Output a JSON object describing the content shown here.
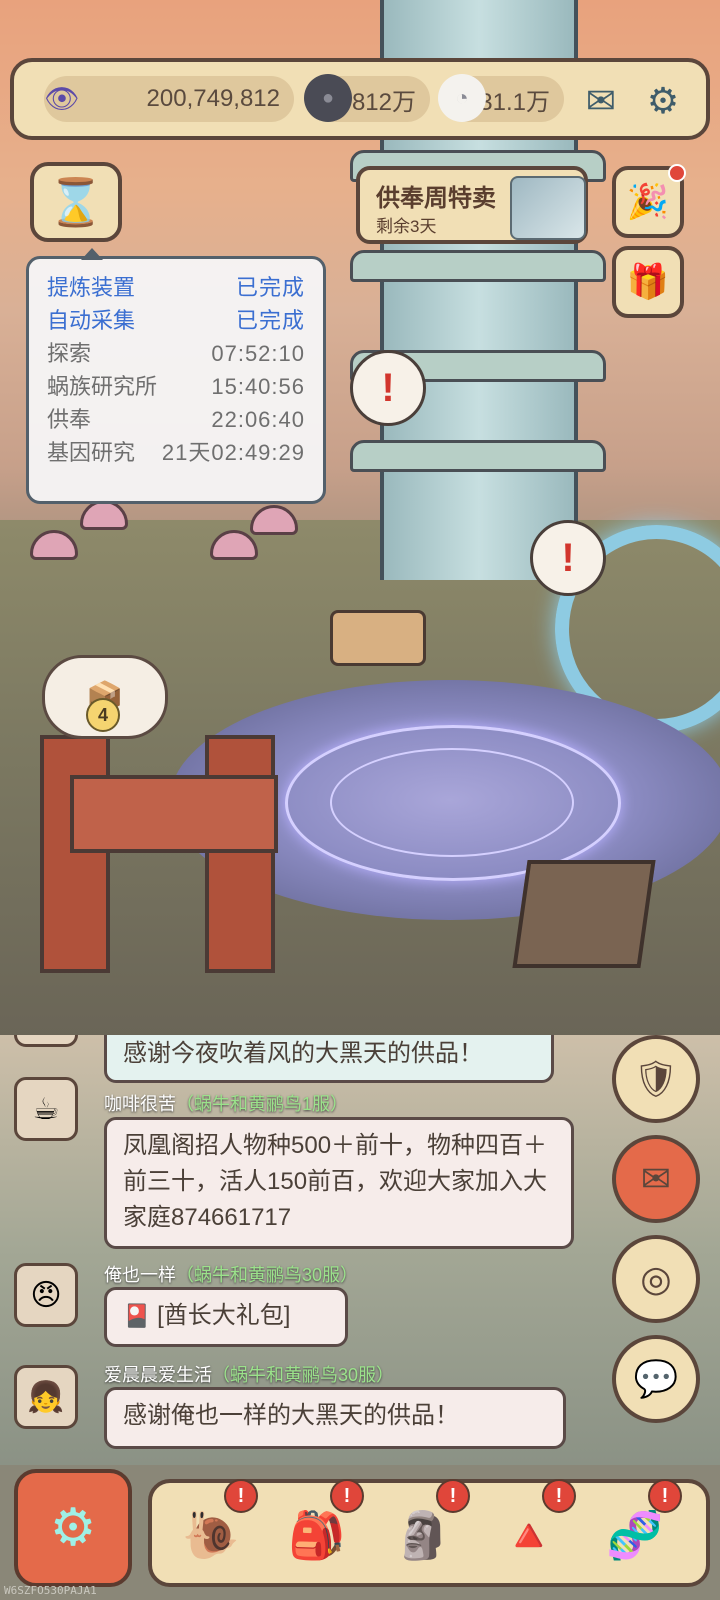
{
  "resources": [
    {
      "icon": "eye-icon",
      "value": "200,749,812"
    },
    {
      "icon": "shadow-orb-icon",
      "value": "812万"
    },
    {
      "icon": "ghost-icon",
      "value": "31.1万"
    }
  ],
  "top_buttons": {
    "mail_icon": "mail-icon",
    "settings_icon": "gear-icon"
  },
  "timer_panel": {
    "rows": [
      {
        "name": "提炼装置",
        "value": "已完成",
        "done": true
      },
      {
        "name": "自动采集",
        "value": "已完成",
        "done": true
      },
      {
        "name": "探索",
        "value": "07:52:10",
        "done": false
      },
      {
        "name": "蜗族研究所",
        "value": "15:40:56",
        "done": false
      },
      {
        "name": "供奉",
        "value": "22:06:40",
        "done": false
      },
      {
        "name": "基因研究",
        "value": "21天02:49:29",
        "done": false
      }
    ]
  },
  "promo": {
    "title": "供奉周特卖",
    "subtitle": "剩余3天"
  },
  "building_badge": "4",
  "alert_mark": "!",
  "chat": {
    "first_message": "感谢今夜吹着风的大黑天的供品！",
    "messages": [
      {
        "name": "咖啡很苦",
        "server": "（蜗牛和黄鹂鸟1服）",
        "text": "凤凰阁招人物种500＋前十，物种四百＋前三十，活人150前百，欢迎大家加入大家庭874661717"
      },
      {
        "name": "俺也一样",
        "server": "（蜗牛和黄鹂鸟30服）",
        "text": "[酋长大礼包]"
      },
      {
        "name": "爱晨晨爱生活",
        "server": "（蜗牛和黄鹂鸟30服）",
        "text": "感谢俺也一样的大黑天的供品！"
      }
    ]
  },
  "bottom_nav": {
    "items": [
      {
        "icon": "snail-icon"
      },
      {
        "icon": "backpack-icon"
      },
      {
        "icon": "statue-icon"
      },
      {
        "icon": "pyramid-icon"
      },
      {
        "icon": "dna-icon"
      }
    ]
  },
  "watermark": "W6SZFO530PAJA1"
}
